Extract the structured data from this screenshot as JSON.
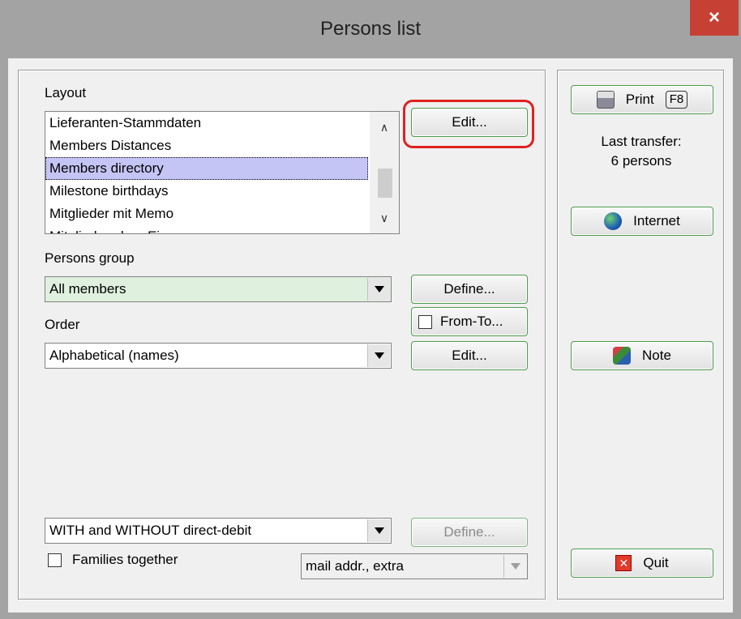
{
  "window": {
    "title": "Persons list",
    "close_label": "×"
  },
  "layout": {
    "label": "Layout",
    "items": [
      "Lieferanten-Stammdaten",
      "Members Distances",
      "Members directory",
      "Milestone birthdays",
      "Mitglieder mit Memo",
      "Mitglieder ohne Einzug"
    ],
    "selected": "Members directory",
    "edit_button": "Edit..."
  },
  "persons_group": {
    "label": "Persons group",
    "value": "All members",
    "define_button": "Define...",
    "from_to_label": "From-To..."
  },
  "order": {
    "label": "Order",
    "value": "Alphabetical (names)",
    "edit_button": "Edit..."
  },
  "direct_debit": {
    "value": "WITH and WITHOUT direct-debit",
    "define_button": "Define..."
  },
  "families": {
    "label": "Families together",
    "checked": false
  },
  "mail_addr": {
    "value": "mail addr., extra"
  },
  "right": {
    "print_label": "Print",
    "print_shortcut": "F8",
    "last_transfer_line1": "Last transfer:",
    "last_transfer_line2": "6 persons",
    "internet_label": "Internet",
    "note_label": "Note",
    "quit_label": "Quit"
  },
  "colors": {
    "accent_border": "#4e9a4e",
    "highlight": "#e02020",
    "selection": "#c5c5f5",
    "group_bg": "#dff0df"
  }
}
